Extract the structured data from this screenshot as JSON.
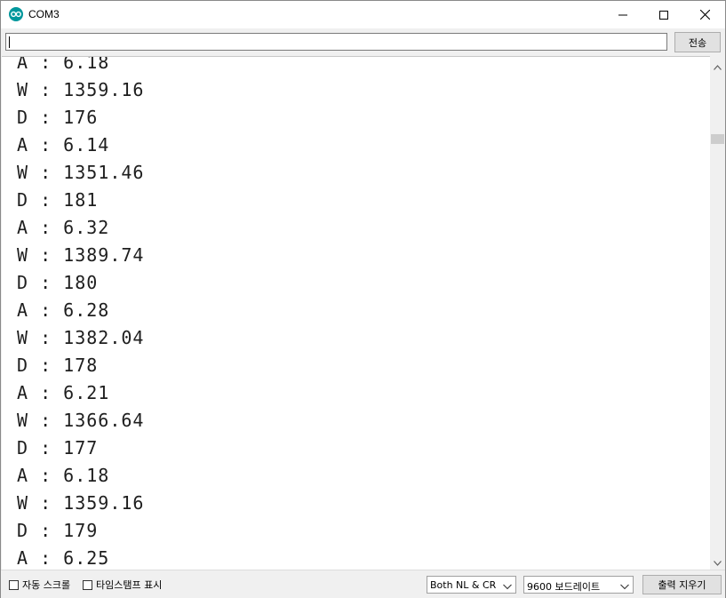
{
  "window": {
    "title": "COM3"
  },
  "send": {
    "input_value": "",
    "button_label": "전송"
  },
  "output": {
    "lines": [
      "A : 6.18",
      "W : 1359.16",
      "D : 176",
      "A : 6.14",
      "W : 1351.46",
      "D : 181",
      "A : 6.32",
      "W : 1389.74",
      "D : 180",
      "A : 6.28",
      "W : 1382.04",
      "D : 178",
      "A : 6.21",
      "W : 1366.64",
      "D : 177",
      "A : 6.18",
      "W : 1359.16",
      "D : 179",
      "A : 6.25"
    ]
  },
  "scrollbar": {
    "position_fraction": 0.13
  },
  "statusbar": {
    "autoscroll_label": "자동 스크롤",
    "autoscroll_checked": false,
    "timestamp_label": "타임스탬프 표시",
    "timestamp_checked": false,
    "line_ending": "Both NL & CR",
    "baud_rate": "9600 보드레이트",
    "clear_label": "출력 지우기"
  },
  "icons": {
    "app": "arduino-icon",
    "minimize": "minimize-icon",
    "maximize": "maximize-icon",
    "close": "close-icon",
    "scroll_up": "chevron-up-icon",
    "scroll_down": "chevron-down-icon",
    "dropdown": "chevron-down-icon"
  },
  "colors": {
    "accent": "#00979c"
  }
}
